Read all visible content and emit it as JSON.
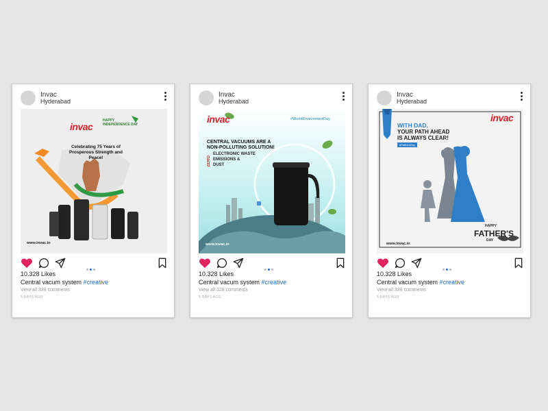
{
  "posts": [
    {
      "account_name": "Invac",
      "location": "Hyderabad",
      "likes": "10.328 Likes",
      "caption_text": "Central vacum system",
      "hashtag": "#creative",
      "comments": "View all 328 comments",
      "time_ago": "5 DAYS AGO",
      "image": {
        "brand": "invac",
        "badge": "HAPPY INDEPENDENCE DAY",
        "headline": "Celebrating 75 Years of Prosperous Strength and Peace!",
        "website": "www.invac.in"
      }
    },
    {
      "account_name": "Invac",
      "location": "Hyderabad",
      "likes": "10.328 Likes",
      "caption_text": "Central vacum system",
      "hashtag": "#creative",
      "comments": "View all 328 comments",
      "time_ago": "5 DAYS AGO",
      "image": {
        "brand": "invac",
        "hashtag": "#WorldEnvironmentDay",
        "headline_1": "CENTRAL VACUUMS ARE A",
        "headline_2": "NON-POLLUTING SOLUTION!",
        "zero": "ZERO",
        "point_1": "ELECTRONIC WASTE",
        "point_2": "EMISSIONS &",
        "point_3": "DUST",
        "website": "www.invac.in"
      }
    },
    {
      "account_name": "Invac",
      "location": "Hyderabad",
      "likes": "10.328 Likes",
      "caption_text": "Central vacum system",
      "hashtag": "#creative",
      "comments": "View all 328 comments",
      "time_ago": "5 DAYS AGO",
      "image": {
        "brand": "invac",
        "headline_1": "WITH DAD,",
        "headline_2": "YOUR PATH AHEAD",
        "headline_3": "IS ALWAYS CLEAR!",
        "tag": "#FathersDay",
        "happy": "HAPPY",
        "fathers": "FATHER'S",
        "day": "DAY",
        "website": "www.invac.in"
      }
    }
  ],
  "colors": {
    "brand_red": "#d3242c",
    "like_red": "#e0245e",
    "hashtag_blue": "#1e6fd1",
    "teal": "#bfeef0"
  },
  "icons": [
    "heart-icon",
    "comment-icon",
    "share-icon",
    "bookmark-icon",
    "more-icon"
  ]
}
